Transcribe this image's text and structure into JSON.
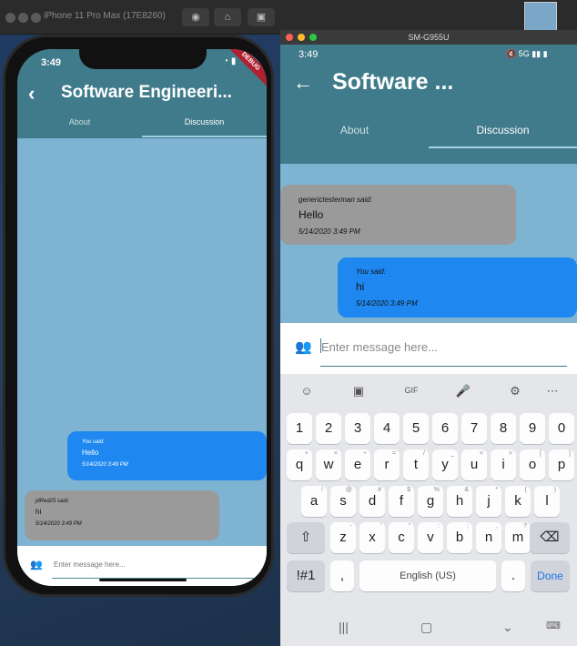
{
  "simulator": {
    "title": "iPhone 11 Pro Max (17E8260)"
  },
  "iphone": {
    "time": "3:49",
    "debug_label": "DEBUG",
    "title": "Software Engineeri...",
    "tabs": [
      "About",
      "Discussion"
    ],
    "messages": [
      {
        "sender": "You said:",
        "text": "Hello",
        "timestamp": "5/14/2020 3:49 PM",
        "mine": true
      },
      {
        "sender": "jdRed25 said:",
        "text": "hi",
        "timestamp": "5/14/2020 3:49 PM",
        "mine": false
      }
    ],
    "input_placeholder": "Enter message here..."
  },
  "android": {
    "window_title": "SM-G955U",
    "time": "3:49",
    "title": "Software ...",
    "tabs": [
      "About",
      "Discussion"
    ],
    "messages": [
      {
        "sender": "generictesterman said:",
        "text": "Hello",
        "timestamp": "5/14/2020 3:49 PM",
        "mine": false
      },
      {
        "sender": "You said:",
        "text": "hi",
        "timestamp": "5/14/2020 3:49 PM",
        "mine": true
      }
    ],
    "input_placeholder": "Enter message here...",
    "keyboard": {
      "row_numbers": [
        "1",
        "2",
        "3",
        "4",
        "5",
        "6",
        "7",
        "8",
        "9",
        "0"
      ],
      "row1": [
        "q",
        "w",
        "e",
        "r",
        "t",
        "y",
        "u",
        "i",
        "o",
        "p"
      ],
      "row1_hints": [
        "+",
        "×",
        "÷",
        "=",
        "/",
        "_",
        "<",
        ">",
        "[",
        "]"
      ],
      "row2": [
        "a",
        "s",
        "d",
        "f",
        "g",
        "h",
        "j",
        "k",
        "l"
      ],
      "row2_hints": [
        "!",
        "@",
        "#",
        "$",
        "%",
        "&",
        "*",
        "(",
        ")"
      ],
      "row3": [
        "z",
        "x",
        "c",
        "v",
        "b",
        "n",
        "m"
      ],
      "row3_hints": [
        "-",
        "'",
        "\"",
        ":",
        ";",
        ",",
        "?"
      ],
      "symbols_label": "!#1",
      "comma_label": ",",
      "space_label": "English (US)",
      "period_label": ".",
      "done_label": "Done",
      "gif_label": "GIF"
    }
  },
  "colors": {
    "appbar": "#3f7b8b",
    "chat_bg": "#7eb3d1",
    "mine_bubble": "#1e88f0",
    "other_bubble": "#9a9a9a"
  }
}
